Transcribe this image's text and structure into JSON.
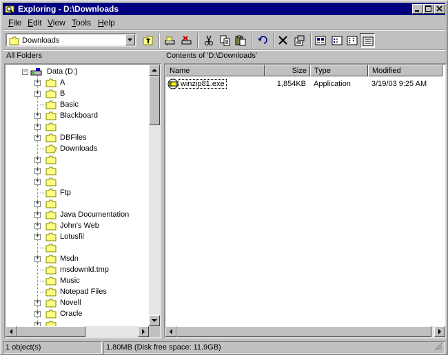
{
  "window": {
    "title": "Exploring - D:\\Downloads"
  },
  "menu": {
    "items": [
      "File",
      "Edit",
      "View",
      "Tools",
      "Help"
    ],
    "underline": [
      "F",
      "E",
      "V",
      "T",
      "H"
    ]
  },
  "toolbar": {
    "address_value": "Downloads"
  },
  "left_pane": {
    "header": "All Folders",
    "drive": "Data (D:)",
    "folders": [
      {
        "label": "A",
        "expandable": true
      },
      {
        "label": "B",
        "expandable": true
      },
      {
        "label": "Basic",
        "expandable": false
      },
      {
        "label": "Blackboard",
        "expandable": true
      },
      {
        "label": "",
        "expandable": true
      },
      {
        "label": "DBFiles",
        "expandable": true
      },
      {
        "label": "Downloads",
        "expandable": false,
        "open": true
      },
      {
        "label": "",
        "expandable": true
      },
      {
        "label": "",
        "expandable": true
      },
      {
        "label": "",
        "expandable": true
      },
      {
        "label": "Ftp",
        "expandable": false
      },
      {
        "label": "",
        "expandable": true
      },
      {
        "label": "Java Documentation",
        "expandable": true
      },
      {
        "label": "John's Web",
        "expandable": true
      },
      {
        "label": "Lotusfil",
        "expandable": true
      },
      {
        "label": "",
        "expandable": false
      },
      {
        "label": "Msdn",
        "expandable": true
      },
      {
        "label": "msdownld.tmp",
        "expandable": false
      },
      {
        "label": "Music",
        "expandable": false
      },
      {
        "label": "Notepad Files",
        "expandable": false
      },
      {
        "label": "Novell",
        "expandable": true
      },
      {
        "label": "Oracle",
        "expandable": true
      },
      {
        "label": "",
        "expandable": true
      }
    ]
  },
  "right_pane": {
    "header": "Contents of 'D:\\Downloads'",
    "columns": [
      "Name",
      "Size",
      "Type",
      "Modified"
    ],
    "files": [
      {
        "name": "winzip81.exe",
        "size": "1,854KB",
        "type": "Application",
        "modified": "3/19/03 9:25 AM"
      }
    ]
  },
  "statusbar": {
    "objects": "1 object(s)",
    "disk": "1.80MB (Disk free space: 11.9GB)"
  },
  "colors": {
    "title_bar": "#000080",
    "face": "#c0c0c0",
    "folder": "#ffff80"
  }
}
